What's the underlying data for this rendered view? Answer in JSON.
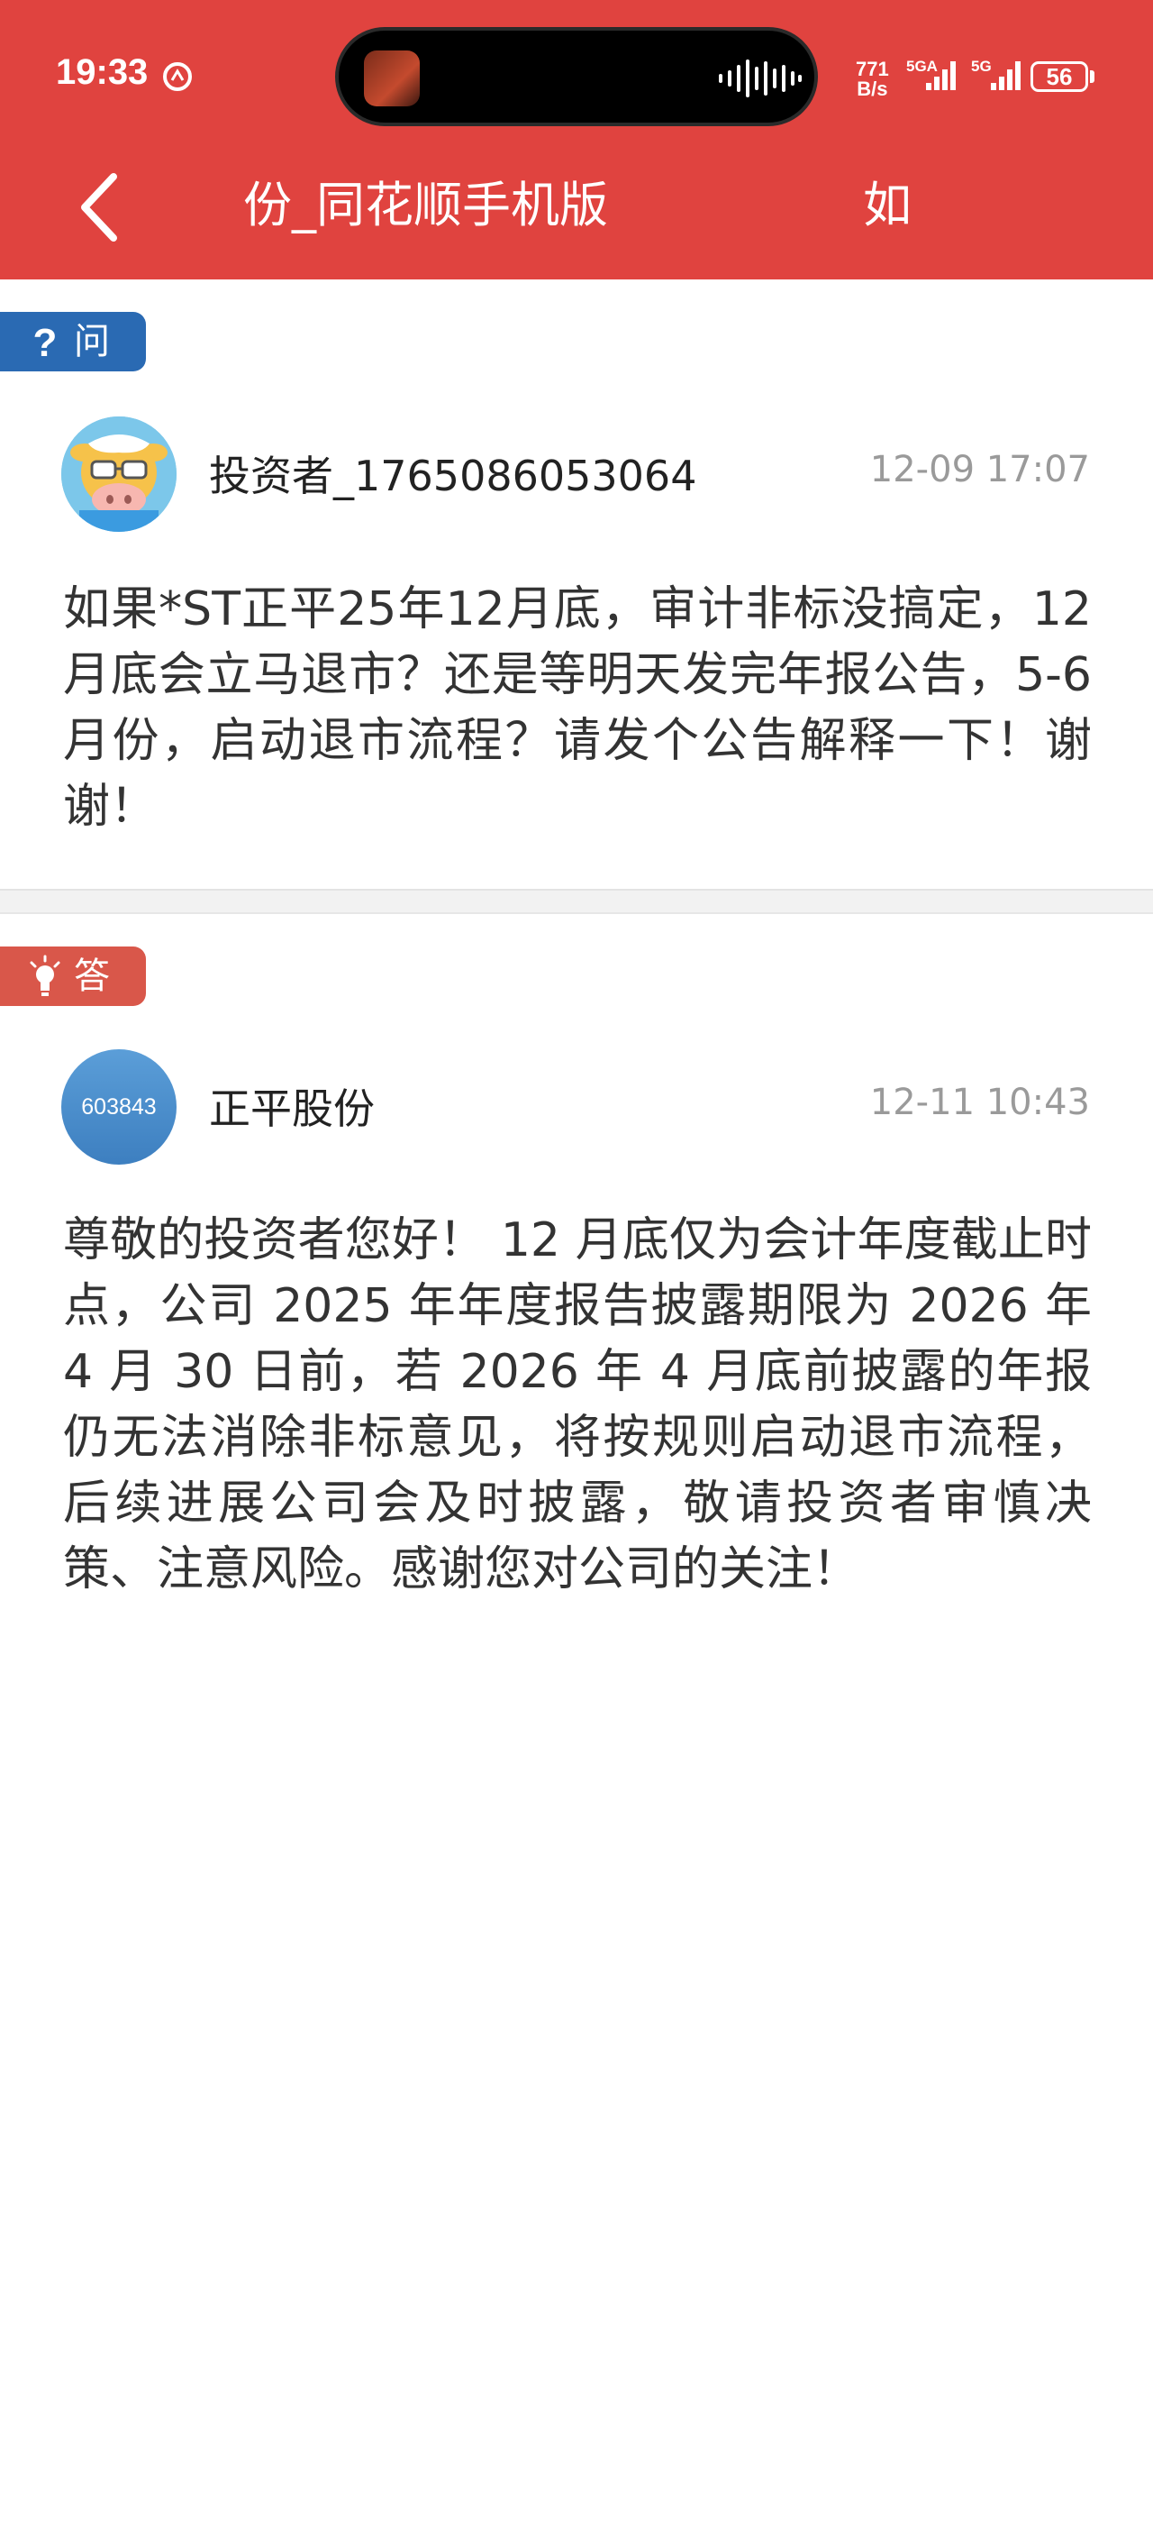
{
  "status_bar": {
    "time": "19:33",
    "net_speed_value": "771",
    "net_speed_unit": "B/s",
    "signal_1_label": "5GA",
    "signal_2_label": "5G",
    "battery": "56"
  },
  "nav": {
    "title": "正平股份_同花顺手机版",
    "title_visible": "份_同花顺手机版",
    "right_text": "如"
  },
  "question": {
    "badge": "问",
    "author": "投资者_1765086053064",
    "time": "12-09 17:07",
    "text": "如果*ST正平25年12月底，审计非标没搞定，12月底会立马退市？还是等明天发完年报公告，5-6月份，启动退市流程？请发个公告解释一下！谢谢！"
  },
  "answer": {
    "badge": "答",
    "avatar_text": "603843",
    "author": "正平股份",
    "time": "12-11 10:43",
    "text": "尊敬的投资者您好！ 12 月底仅为会计年度截止时点，公司 2025 年年度报告披露期限为 2026 年 4 月 30 日前，若 2026 年 4 月底前披露的年报仍无法消除非标意见，将按规则启动退市流程，后续进展公司会及时披露，敬请投资者审慎决策、注意风险。感谢您对公司的关注！"
  },
  "colors": {
    "header_red": "#e0433f",
    "question_badge": "#2a6ab3",
    "answer_badge": "#d9574a",
    "timestamp_gray": "#9a9a9a"
  },
  "icons": {
    "back": "chevron-left-icon",
    "question": "question-mark-icon",
    "answer": "lightbulb-icon"
  }
}
